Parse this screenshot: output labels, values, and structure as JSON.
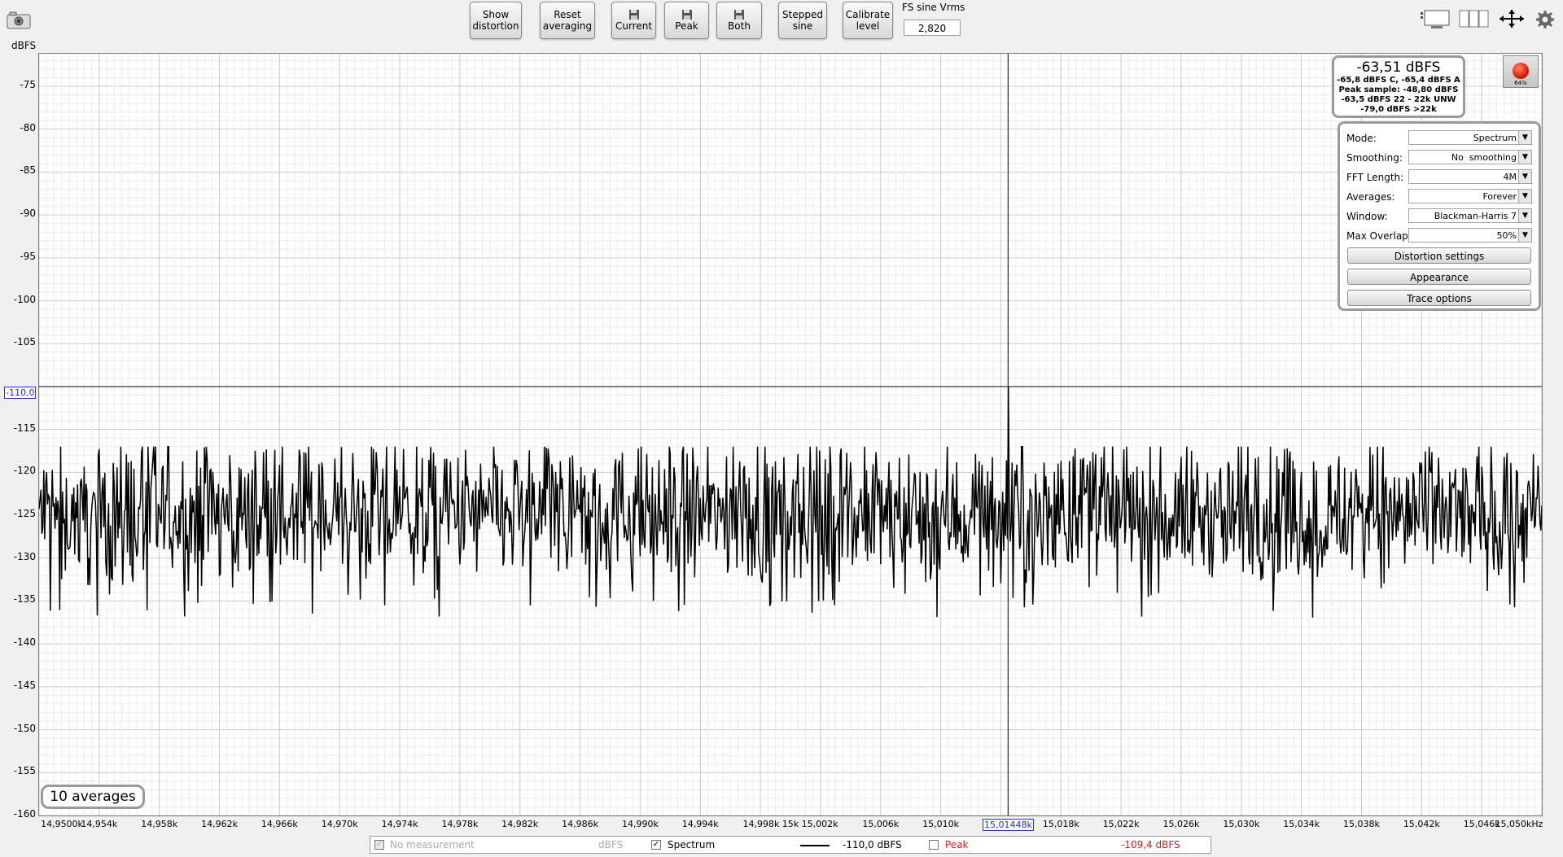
{
  "toolbar": {
    "show_distortion": "Show\ndistortion",
    "reset_averaging": "Reset\naveraging",
    "current": "Current",
    "peak": "Peak",
    "both": "Both",
    "stepped_sine": "Stepped\nsine",
    "calibrate_level": "Calibrate\nlevel",
    "fs_label": "FS sine Vrms",
    "fs_value": "2,820"
  },
  "axis": {
    "y_unit": "dBFS",
    "cursor_y": "-110,0",
    "cursor_x": "15,01448k"
  },
  "readout": {
    "main": "-63,51 dBFS",
    "line1": "-65,8 dBFS C, -65,4 dBFS A",
    "line2": "Peak sample: -48,80 dBFS",
    "line3": "-63,5 dBFS 22 - 22k UNW",
    "line4": "-79,0 dBFS >22k"
  },
  "record": {
    "percent": "64%"
  },
  "settings": {
    "mode_label": "Mode:",
    "mode_value": "Spectrum",
    "smoothing_label": "Smoothing:",
    "smoothing_value": "No  smoothing",
    "fft_label": "FFT Length:",
    "fft_value": "4M",
    "averages_label": "Averages:",
    "averages_value": "Forever",
    "window_label": "Window:",
    "window_value": "Blackman-Harris 7",
    "overlap_label": "Max Overlap:",
    "overlap_value": "50%",
    "distortion_settings": "Distortion settings",
    "appearance": "Appearance",
    "trace_options": "Trace options"
  },
  "averages_badge": "10 averages",
  "legend": {
    "no_measurement": "No measurement",
    "no_measurement_unit": "dBFS",
    "spectrum": "Spectrum",
    "spectrum_value": "-110,0 dBFS",
    "peak": "Peak",
    "peak_value": "-109,4 dBFS",
    "peak_color": "#cc2222"
  },
  "chart_data": {
    "type": "line",
    "ylabel": "dBFS",
    "ylim": [
      -160,
      -70
    ],
    "xlim": [
      14950,
      15050
    ],
    "x_unit": "Hz (k)",
    "y_ticks": [
      "-75",
      "-80",
      "-85",
      "-90",
      "-95",
      "-100",
      "-105",
      "-110,0",
      "-115",
      "-120",
      "-125",
      "-130",
      "-135",
      "-140",
      "-145",
      "-150",
      "-155",
      "-160"
    ],
    "x_ticks": [
      "14,9500k",
      "14,954k",
      "14,958k",
      "14,962k",
      "14,966k",
      "14,970k",
      "14,974k",
      "14,978k",
      "14,982k",
      "14,986k",
      "14,990k",
      "14,994k",
      "14,998k 15k 15,002k",
      "15,006k",
      "15,010k",
      "15,01448k",
      "15,018k",
      "15,022k",
      "15,026k",
      "15,030k",
      "15,034k",
      "15,038k",
      "15,042k",
      "15,046k",
      "15,050kHz"
    ],
    "series": [
      {
        "name": "Spectrum",
        "mean_level": -125,
        "noise_min": -137,
        "noise_max": -117,
        "peak_at_x": 15014.48,
        "peak_value": -110.0
      }
    ],
    "cursor": {
      "x": 15014.48,
      "y": -110.0
    },
    "grid": true
  }
}
